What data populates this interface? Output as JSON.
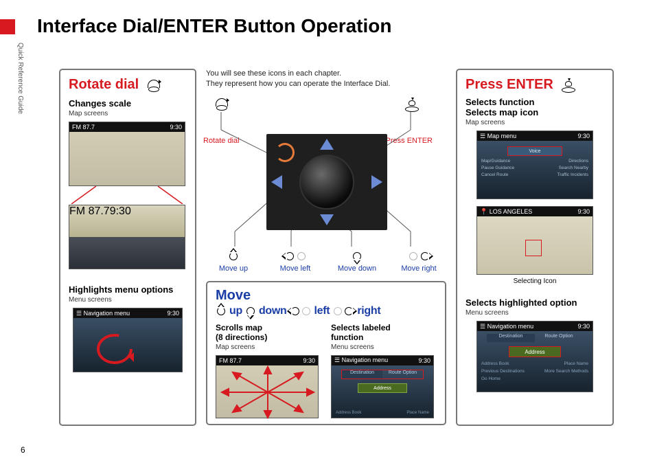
{
  "page_title": "Interface Dial/ENTER Button Operation",
  "side_title": "Quick Reference Guide",
  "page_number": "6",
  "intro_line1": "You will see these icons in each chapter.",
  "intro_line2": "They represent how you can operate the Interface Dial.",
  "rotate": {
    "title": "Rotate dial",
    "h1": "Changes scale",
    "s1": "Map screens",
    "h2": "Highlights menu options",
    "s2": "Menu screens"
  },
  "move": {
    "title": "Move",
    "up": "up",
    "down": "down",
    "left": "left",
    "right": "right",
    "h1": "Scrolls map",
    "h1b": "(8 directions)",
    "s1": "Map screens",
    "h2": "Selects labeled",
    "h2b": "function",
    "s2": "Menu screens"
  },
  "press": {
    "title": "Press ENTER",
    "h1": "Selects function",
    "h1b": "Selects map icon",
    "s1": "Map screens",
    "caption1": "Selecting Icon",
    "h2": "Selects highlighted option",
    "s2": "Menu screens"
  },
  "callouts": {
    "rotate": "Rotate dial",
    "press": "Press ENTER",
    "up": "Move up",
    "down": "Move down",
    "left": "Move left",
    "right": "Move right"
  },
  "shot": {
    "fm": "FM",
    "freq": "87.7",
    "time": "9:30",
    "mapmenu": "Map menu",
    "navmenu": "Navigation menu",
    "la": "LOS ANGELES",
    "voice": "Voice",
    "mapguid": "Map/Guidance",
    "directions": "Directions",
    "pause": "Pause Guidance",
    "search": "Search Nearby",
    "cancel": "Cancel Route",
    "traffic": "Traffic Incidents",
    "dest": "Destination",
    "route": "Route Option",
    "address": "Address",
    "addrbook": "Address Book",
    "prev": "Previous Destinations",
    "place": "Place Name",
    "more": "More Search Methods",
    "gohome": "Go Home"
  }
}
